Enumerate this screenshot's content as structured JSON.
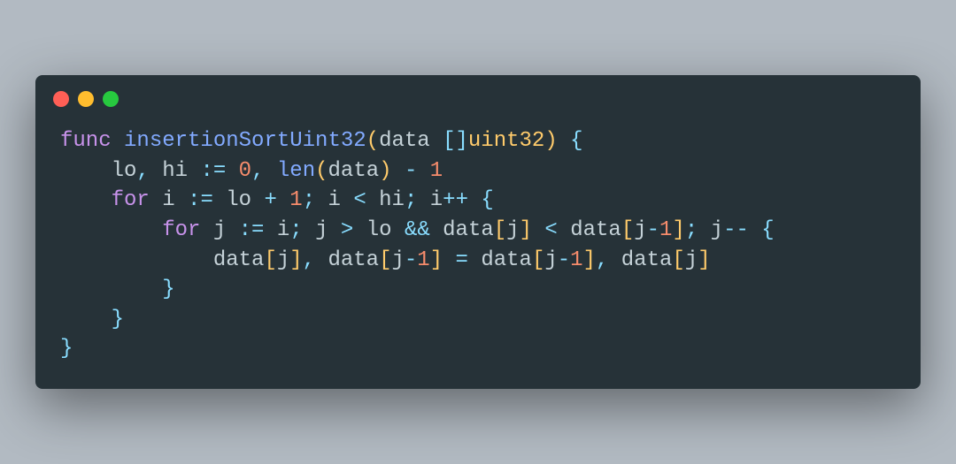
{
  "window": {
    "buttons": {
      "close": "close",
      "minimize": "minimize",
      "zoom": "zoom"
    }
  },
  "code": {
    "language": "go",
    "colors": {
      "background": "#263238",
      "foreground": "#c5d2d8",
      "keyword": "#c792ea",
      "function": "#82aaff",
      "number": "#f78c6c",
      "type": "#ffcb6b",
      "operator": "#89ddff",
      "paren1": "#ffcb6b",
      "paren2": "#c792ea"
    },
    "tokens": {
      "kw_func": "func",
      "fn_name": "insertionSortUint32",
      "param_name": "data",
      "slice_open": "[]",
      "type_uint32": "uint32",
      "lbrace": "{",
      "rbrace": "}",
      "id_lo": "lo",
      "id_hi": "hi",
      "op_decl": ":=",
      "num_0": "0",
      "comma": ",",
      "fn_len": "len",
      "op_minus": "-",
      "num_1a": "1",
      "kw_for": "for",
      "id_i": "i",
      "op_plus": "+",
      "num_1b": "1",
      "semi": ";",
      "op_lt": "<",
      "op_inc": "++",
      "id_j": "j",
      "op_gt": ">",
      "op_and": "&&",
      "lbr": "[",
      "rbr": "]",
      "num_1c": "1",
      "op_dec": "--",
      "op_eq": "=",
      "id_data": "data",
      "lparen": "(",
      "rparen": ")"
    },
    "plain_text": "func insertionSortUint32(data []uint32) {\n    lo, hi := 0, len(data) - 1\n    for i := lo + 1; i < hi; i++ {\n        for j := i; j > lo && data[j] < data[j-1]; j-- {\n            data[j], data[j-1] = data[j-1], data[j]\n        }\n    }\n}"
  }
}
